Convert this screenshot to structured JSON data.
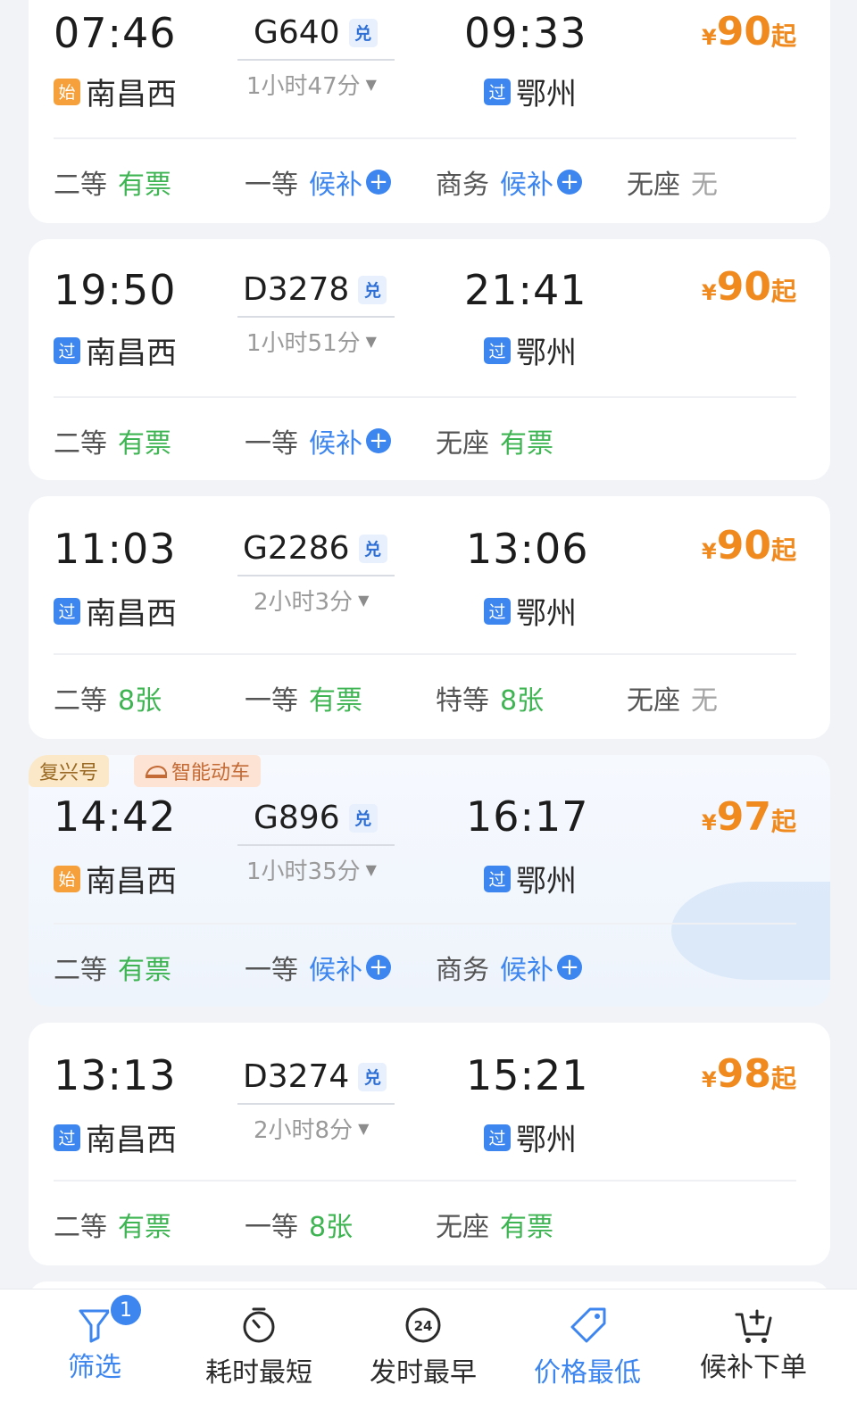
{
  "trains": [
    {
      "dep_time": "07:46",
      "dep_badge": "始",
      "dep_station": "南昌西",
      "train_no": "G640",
      "exchange": "兑",
      "duration": "1小时47分",
      "arr_time": "09:33",
      "arr_badge": "过",
      "arr_station": "鄂州",
      "price_symbol": "¥",
      "price": "90",
      "price_suffix": "起",
      "seats": [
        {
          "cls": "二等",
          "status": "有票"
        },
        {
          "cls": "一等",
          "status": "候补"
        },
        {
          "cls": "商务",
          "status": "候补"
        },
        {
          "cls": "无座",
          "status": "无"
        }
      ]
    },
    {
      "dep_time": "19:50",
      "dep_badge": "过",
      "dep_station": "南昌西",
      "train_no": "D3278",
      "exchange": "兑",
      "duration": "1小时51分",
      "arr_time": "21:41",
      "arr_badge": "过",
      "arr_station": "鄂州",
      "price_symbol": "¥",
      "price": "90",
      "price_suffix": "起",
      "seats": [
        {
          "cls": "二等",
          "status": "有票"
        },
        {
          "cls": "一等",
          "status": "候补"
        },
        {
          "cls": "无座",
          "status": "有票"
        }
      ]
    },
    {
      "dep_time": "11:03",
      "dep_badge": "过",
      "dep_station": "南昌西",
      "train_no": "G2286",
      "exchange": "兑",
      "duration": "2小时3分",
      "arr_time": "13:06",
      "arr_badge": "过",
      "arr_station": "鄂州",
      "price_symbol": "¥",
      "price": "90",
      "price_suffix": "起",
      "seats": [
        {
          "cls": "二等",
          "status": "8张"
        },
        {
          "cls": "一等",
          "status": "有票"
        },
        {
          "cls": "特等",
          "status": "8张"
        },
        {
          "cls": "无座",
          "status": "无"
        }
      ]
    },
    {
      "tags": [
        "复兴号",
        "智能动车"
      ],
      "dep_time": "14:42",
      "dep_badge": "始",
      "dep_station": "南昌西",
      "train_no": "G896",
      "exchange": "兑",
      "duration": "1小时35分",
      "arr_time": "16:17",
      "arr_badge": "过",
      "arr_station": "鄂州",
      "price_symbol": "¥",
      "price": "97",
      "price_suffix": "起",
      "seats": [
        {
          "cls": "二等",
          "status": "有票"
        },
        {
          "cls": "一等",
          "status": "候补"
        },
        {
          "cls": "商务",
          "status": "候补"
        }
      ]
    },
    {
      "dep_time": "13:13",
      "dep_badge": "过",
      "dep_station": "南昌西",
      "train_no": "D3274",
      "exchange": "兑",
      "duration": "2小时8分",
      "arr_time": "15:21",
      "arr_badge": "过",
      "arr_station": "鄂州",
      "price_symbol": "¥",
      "price": "98",
      "price_suffix": "起",
      "seats": [
        {
          "cls": "二等",
          "status": "有票"
        },
        {
          "cls": "一等",
          "status": "8张"
        },
        {
          "cls": "无座",
          "status": "有票"
        }
      ]
    }
  ],
  "tabbar": {
    "filter_label": "筛选",
    "filter_count": "1",
    "shortest_label": "耗时最短",
    "earliest_label": "发时最早",
    "earliest_icon_text": "24",
    "cheapest_label": "价格最低",
    "waitlist_label": "候补下单"
  },
  "colors": {
    "available": "#3eb452",
    "waitlist": "#3d86f0",
    "none": "#a5a5a5",
    "price": "#f08a1e",
    "accent": "#3d86f0"
  },
  "icons": {
    "filter": "funnel-icon",
    "shortest": "stopwatch-icon",
    "earliest": "clock-24-icon",
    "cheapest": "price-tag-icon",
    "waitlist": "cart-plus-icon"
  }
}
